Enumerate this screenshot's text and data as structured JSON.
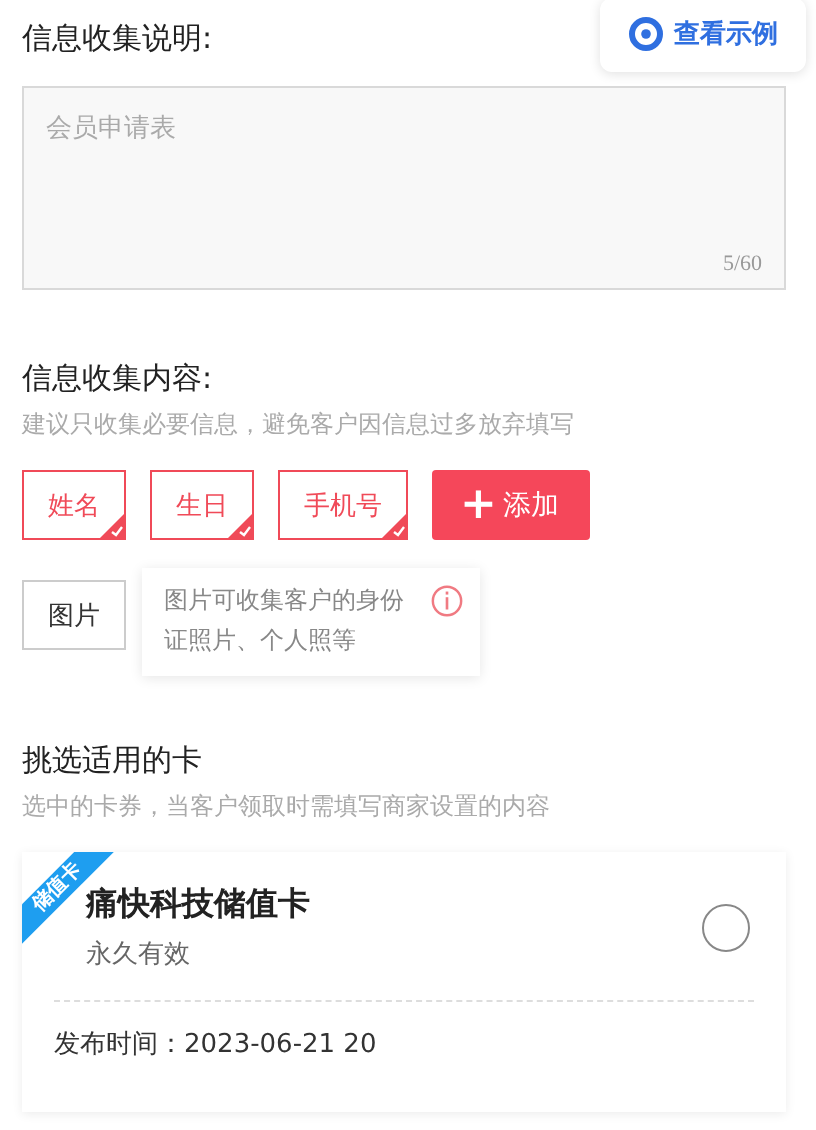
{
  "description": {
    "label": "信息收集说明:",
    "example_button": "查看示例",
    "placeholder": "会员申请表",
    "counter": "5/60"
  },
  "collect": {
    "label": "信息收集内容:",
    "hint": "建议只收集必要信息，避免客户因信息过多放弃填写",
    "fields": [
      {
        "label": "姓名",
        "selected": true
      },
      {
        "label": "生日",
        "selected": true
      },
      {
        "label": "手机号",
        "selected": true
      },
      {
        "label": "图片",
        "selected": false
      }
    ],
    "add_button": {
      "icon": "+",
      "label": "添加"
    },
    "tooltip": "图片可收集客户的身份证照片、个人照等"
  },
  "cards": {
    "label": "挑选适用的卡",
    "hint": "选中的卡券，当客户领取时需填写商家设置的内容",
    "items": [
      {
        "ribbon": "储值卡",
        "title": "痛快科技储值卡",
        "validity": "永久有效",
        "published": "发布时间：2023-06-21 20",
        "selected": false
      }
    ]
  }
}
